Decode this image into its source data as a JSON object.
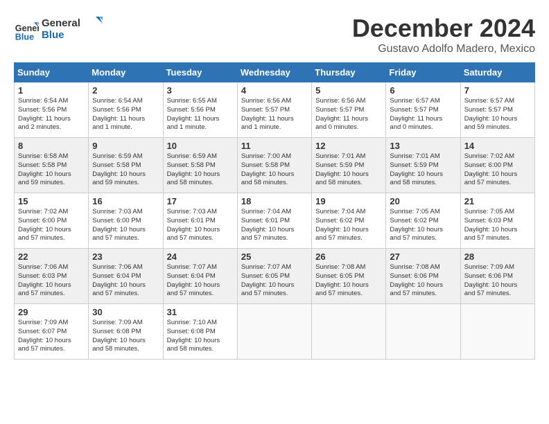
{
  "logo": {
    "line1": "General",
    "line2": "Blue"
  },
  "title": "December 2024",
  "subtitle": "Gustavo Adolfo Madero, Mexico",
  "days_header": [
    "Sunday",
    "Monday",
    "Tuesday",
    "Wednesday",
    "Thursday",
    "Friday",
    "Saturday"
  ],
  "weeks": [
    [
      {
        "day": "1",
        "lines": [
          "Sunrise: 6:54 AM",
          "Sunset: 5:56 PM",
          "Daylight: 11 hours",
          "and 2 minutes."
        ]
      },
      {
        "day": "2",
        "lines": [
          "Sunrise: 6:54 AM",
          "Sunset: 5:56 PM",
          "Daylight: 11 hours",
          "and 1 minute."
        ]
      },
      {
        "day": "3",
        "lines": [
          "Sunrise: 6:55 AM",
          "Sunset: 5:56 PM",
          "Daylight: 11 hours",
          "and 1 minute."
        ]
      },
      {
        "day": "4",
        "lines": [
          "Sunrise: 6:56 AM",
          "Sunset: 5:57 PM",
          "Daylight: 11 hours",
          "and 1 minute."
        ]
      },
      {
        "day": "5",
        "lines": [
          "Sunrise: 6:56 AM",
          "Sunset: 5:57 PM",
          "Daylight: 11 hours",
          "and 0 minutes."
        ]
      },
      {
        "day": "6",
        "lines": [
          "Sunrise: 6:57 AM",
          "Sunset: 5:57 PM",
          "Daylight: 11 hours",
          "and 0 minutes."
        ]
      },
      {
        "day": "7",
        "lines": [
          "Sunrise: 6:57 AM",
          "Sunset: 5:57 PM",
          "Daylight: 10 hours",
          "and 59 minutes."
        ]
      }
    ],
    [
      {
        "day": "8",
        "lines": [
          "Sunrise: 6:58 AM",
          "Sunset: 5:58 PM",
          "Daylight: 10 hours",
          "and 59 minutes."
        ]
      },
      {
        "day": "9",
        "lines": [
          "Sunrise: 6:59 AM",
          "Sunset: 5:58 PM",
          "Daylight: 10 hours",
          "and 59 minutes."
        ]
      },
      {
        "day": "10",
        "lines": [
          "Sunrise: 6:59 AM",
          "Sunset: 5:58 PM",
          "Daylight: 10 hours",
          "and 58 minutes."
        ]
      },
      {
        "day": "11",
        "lines": [
          "Sunrise: 7:00 AM",
          "Sunset: 5:58 PM",
          "Daylight: 10 hours",
          "and 58 minutes."
        ]
      },
      {
        "day": "12",
        "lines": [
          "Sunrise: 7:01 AM",
          "Sunset: 5:59 PM",
          "Daylight: 10 hours",
          "and 58 minutes."
        ]
      },
      {
        "day": "13",
        "lines": [
          "Sunrise: 7:01 AM",
          "Sunset: 5:59 PM",
          "Daylight: 10 hours",
          "and 58 minutes."
        ]
      },
      {
        "day": "14",
        "lines": [
          "Sunrise: 7:02 AM",
          "Sunset: 6:00 PM",
          "Daylight: 10 hours",
          "and 57 minutes."
        ]
      }
    ],
    [
      {
        "day": "15",
        "lines": [
          "Sunrise: 7:02 AM",
          "Sunset: 6:00 PM",
          "Daylight: 10 hours",
          "and 57 minutes."
        ]
      },
      {
        "day": "16",
        "lines": [
          "Sunrise: 7:03 AM",
          "Sunset: 6:00 PM",
          "Daylight: 10 hours",
          "and 57 minutes."
        ]
      },
      {
        "day": "17",
        "lines": [
          "Sunrise: 7:03 AM",
          "Sunset: 6:01 PM",
          "Daylight: 10 hours",
          "and 57 minutes."
        ]
      },
      {
        "day": "18",
        "lines": [
          "Sunrise: 7:04 AM",
          "Sunset: 6:01 PM",
          "Daylight: 10 hours",
          "and 57 minutes."
        ]
      },
      {
        "day": "19",
        "lines": [
          "Sunrise: 7:04 AM",
          "Sunset: 6:02 PM",
          "Daylight: 10 hours",
          "and 57 minutes."
        ]
      },
      {
        "day": "20",
        "lines": [
          "Sunrise: 7:05 AM",
          "Sunset: 6:02 PM",
          "Daylight: 10 hours",
          "and 57 minutes."
        ]
      },
      {
        "day": "21",
        "lines": [
          "Sunrise: 7:05 AM",
          "Sunset: 6:03 PM",
          "Daylight: 10 hours",
          "and 57 minutes."
        ]
      }
    ],
    [
      {
        "day": "22",
        "lines": [
          "Sunrise: 7:06 AM",
          "Sunset: 6:03 PM",
          "Daylight: 10 hours",
          "and 57 minutes."
        ]
      },
      {
        "day": "23",
        "lines": [
          "Sunrise: 7:06 AM",
          "Sunset: 6:04 PM",
          "Daylight: 10 hours",
          "and 57 minutes."
        ]
      },
      {
        "day": "24",
        "lines": [
          "Sunrise: 7:07 AM",
          "Sunset: 6:04 PM",
          "Daylight: 10 hours",
          "and 57 minutes."
        ]
      },
      {
        "day": "25",
        "lines": [
          "Sunrise: 7:07 AM",
          "Sunset: 6:05 PM",
          "Daylight: 10 hours",
          "and 57 minutes."
        ]
      },
      {
        "day": "26",
        "lines": [
          "Sunrise: 7:08 AM",
          "Sunset: 6:05 PM",
          "Daylight: 10 hours",
          "and 57 minutes."
        ]
      },
      {
        "day": "27",
        "lines": [
          "Sunrise: 7:08 AM",
          "Sunset: 6:06 PM",
          "Daylight: 10 hours",
          "and 57 minutes."
        ]
      },
      {
        "day": "28",
        "lines": [
          "Sunrise: 7:09 AM",
          "Sunset: 6:06 PM",
          "Daylight: 10 hours",
          "and 57 minutes."
        ]
      }
    ],
    [
      {
        "day": "29",
        "lines": [
          "Sunrise: 7:09 AM",
          "Sunset: 6:07 PM",
          "Daylight: 10 hours",
          "and 57 minutes."
        ]
      },
      {
        "day": "30",
        "lines": [
          "Sunrise: 7:09 AM",
          "Sunset: 6:08 PM",
          "Daylight: 10 hours",
          "and 58 minutes."
        ]
      },
      {
        "day": "31",
        "lines": [
          "Sunrise: 7:10 AM",
          "Sunset: 6:08 PM",
          "Daylight: 10 hours",
          "and 58 minutes."
        ]
      },
      null,
      null,
      null,
      null
    ]
  ]
}
